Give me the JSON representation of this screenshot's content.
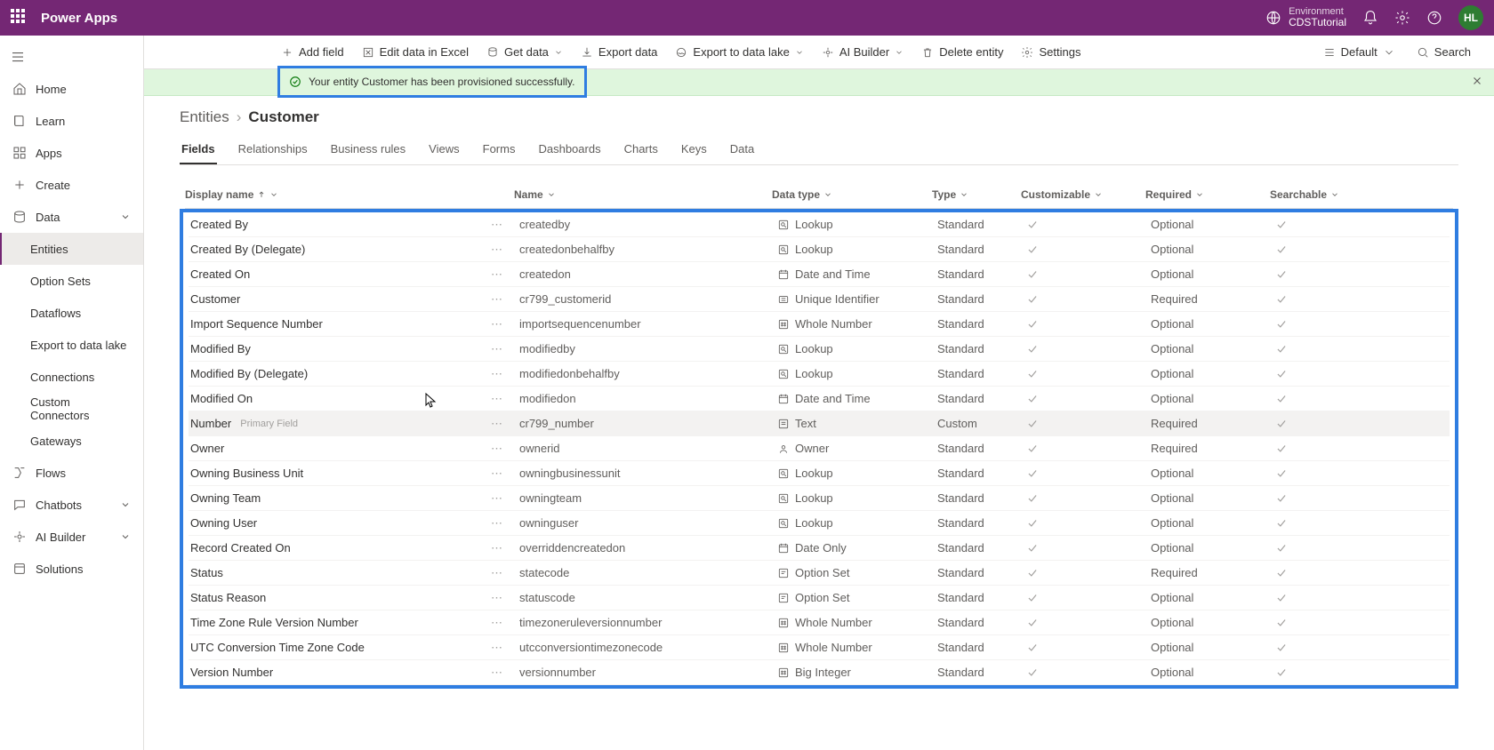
{
  "header": {
    "product": "Power Apps",
    "env_label": "Environment",
    "env_name": "CDSTutorial",
    "avatar": "HL"
  },
  "sidebar": {
    "items": [
      {
        "icon": "home",
        "label": "Home"
      },
      {
        "icon": "book",
        "label": "Learn"
      },
      {
        "icon": "grid",
        "label": "Apps"
      },
      {
        "icon": "plus",
        "label": "Create"
      },
      {
        "icon": "db",
        "label": "Data",
        "expand": true
      },
      {
        "child": true,
        "label": "Entities",
        "active": true
      },
      {
        "child": true,
        "label": "Option Sets"
      },
      {
        "child": true,
        "label": "Dataflows"
      },
      {
        "child": true,
        "label": "Export to data lake"
      },
      {
        "child": true,
        "label": "Connections"
      },
      {
        "child": true,
        "label": "Custom Connectors"
      },
      {
        "child": true,
        "label": "Gateways"
      },
      {
        "icon": "flow",
        "label": "Flows"
      },
      {
        "icon": "chat",
        "label": "Chatbots",
        "expand": true
      },
      {
        "icon": "ai",
        "label": "AI Builder",
        "expand": true
      },
      {
        "icon": "sol",
        "label": "Solutions"
      }
    ]
  },
  "cmdbar": {
    "items": [
      {
        "icon": "plus",
        "label": "Add field"
      },
      {
        "icon": "excel",
        "label": "Edit data in Excel"
      },
      {
        "icon": "getdata",
        "label": "Get data",
        "chev": true
      },
      {
        "icon": "export",
        "label": "Export data"
      },
      {
        "icon": "lake",
        "label": "Export to data lake",
        "chev": true
      },
      {
        "icon": "ai",
        "label": "AI Builder",
        "chev": true
      },
      {
        "icon": "delete",
        "label": "Delete entity"
      },
      {
        "icon": "gear",
        "label": "Settings"
      }
    ],
    "view": "Default",
    "search": "Search"
  },
  "notification": "Your entity Customer has been provisioned successfully.",
  "breadcrumb": {
    "root": "Entities",
    "current": "Customer"
  },
  "tabs": [
    "Fields",
    "Relationships",
    "Business rules",
    "Views",
    "Forms",
    "Dashboards",
    "Charts",
    "Keys",
    "Data"
  ],
  "active_tab": "Fields",
  "columns": [
    "Display name",
    "Name",
    "Data type",
    "Type",
    "Customizable",
    "Required",
    "Searchable"
  ],
  "rows": [
    {
      "display": "Created By",
      "name": "createdby",
      "dtype": "Lookup",
      "type": "Standard",
      "req": "Optional"
    },
    {
      "display": "Created By (Delegate)",
      "name": "createdonbehalfby",
      "dtype": "Lookup",
      "type": "Standard",
      "req": "Optional"
    },
    {
      "display": "Created On",
      "name": "createdon",
      "dtype": "Date and Time",
      "type": "Standard",
      "req": "Optional"
    },
    {
      "display": "Customer",
      "name": "cr799_customerid",
      "dtype": "Unique Identifier",
      "type": "Standard",
      "req": "Required"
    },
    {
      "display": "Import Sequence Number",
      "name": "importsequencenumber",
      "dtype": "Whole Number",
      "type": "Standard",
      "req": "Optional"
    },
    {
      "display": "Modified By",
      "name": "modifiedby",
      "dtype": "Lookup",
      "type": "Standard",
      "req": "Optional"
    },
    {
      "display": "Modified By (Delegate)",
      "name": "modifiedonbehalfby",
      "dtype": "Lookup",
      "type": "Standard",
      "req": "Optional"
    },
    {
      "display": "Modified On",
      "name": "modifiedon",
      "dtype": "Date and Time",
      "type": "Standard",
      "req": "Optional"
    },
    {
      "display": "Number",
      "primary": "Primary Field",
      "name": "cr799_number",
      "dtype": "Text",
      "type": "Custom",
      "req": "Required",
      "hovered": true
    },
    {
      "display": "Owner",
      "name": "ownerid",
      "dtype": "Owner",
      "type": "Standard",
      "req": "Required"
    },
    {
      "display": "Owning Business Unit",
      "name": "owningbusinessunit",
      "dtype": "Lookup",
      "type": "Standard",
      "req": "Optional"
    },
    {
      "display": "Owning Team",
      "name": "owningteam",
      "dtype": "Lookup",
      "type": "Standard",
      "req": "Optional"
    },
    {
      "display": "Owning User",
      "name": "owninguser",
      "dtype": "Lookup",
      "type": "Standard",
      "req": "Optional"
    },
    {
      "display": "Record Created On",
      "name": "overriddencreatedon",
      "dtype": "Date Only",
      "type": "Standard",
      "req": "Optional"
    },
    {
      "display": "Status",
      "name": "statecode",
      "dtype": "Option Set",
      "type": "Standard",
      "req": "Required"
    },
    {
      "display": "Status Reason",
      "name": "statuscode",
      "dtype": "Option Set",
      "type": "Standard",
      "req": "Optional"
    },
    {
      "display": "Time Zone Rule Version Number",
      "name": "timezoneruleversionnumber",
      "dtype": "Whole Number",
      "type": "Standard",
      "req": "Optional"
    },
    {
      "display": "UTC Conversion Time Zone Code",
      "name": "utcconversiontimezonecode",
      "dtype": "Whole Number",
      "type": "Standard",
      "req": "Optional"
    },
    {
      "display": "Version Number",
      "name": "versionnumber",
      "dtype": "Big Integer",
      "type": "Standard",
      "req": "Optional"
    }
  ]
}
